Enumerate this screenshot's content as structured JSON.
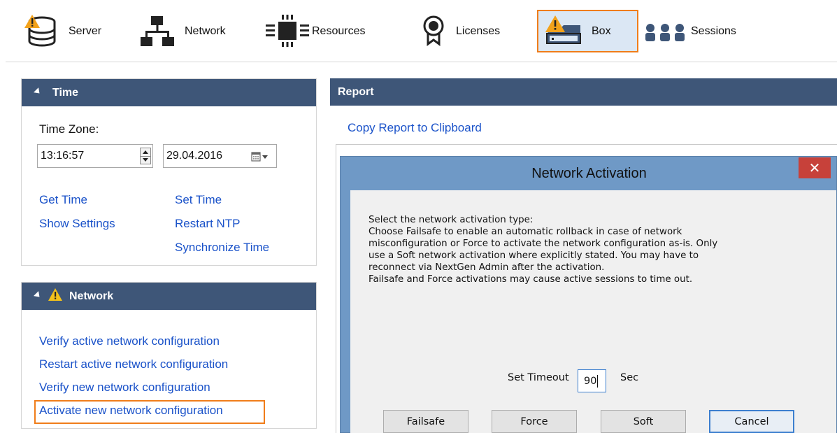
{
  "toolbar": {
    "items": [
      {
        "label": "Server",
        "icon": "database-warning-icon"
      },
      {
        "label": "Network",
        "icon": "network-icon"
      },
      {
        "label": "Resources",
        "icon": "chip-icon"
      },
      {
        "label": "Licenses",
        "icon": "certificate-icon"
      },
      {
        "label": "Box",
        "icon": "box-warning-icon",
        "selected": true
      },
      {
        "label": "Sessions",
        "icon": "users-icon"
      }
    ]
  },
  "time_panel": {
    "title": "Time",
    "timezone_label": "Time Zone:",
    "time_value": "13:16:57",
    "date_value": "29.04.2016",
    "links": {
      "get_time": "Get Time",
      "set_time": "Set Time",
      "show_settings": "Show Settings",
      "restart_ntp": "Restart NTP",
      "synchronize_time": "Synchronize Time"
    }
  },
  "network_panel": {
    "title": "Network",
    "links": {
      "verify_active": "Verify active network configuration",
      "restart_active": "Restart active network configuration",
      "verify_new": "Verify new network configuration",
      "activate_new": "Activate new network configuration"
    }
  },
  "report": {
    "title": "Report",
    "copy_link": "Copy Report to Clipboard"
  },
  "dialog": {
    "title": "Network Activation",
    "close": "✕",
    "message": [
      "Select the network activation type:",
      "Choose Failsafe to enable an automatic rollback in case of network",
      "misconfiguration or Force to activate the network configuration as-is. Only",
      "use a Soft network activation where explicitly stated. You may have to",
      "reconnect via NextGen Admin after the activation.",
      "Failsafe and Force activations may cause active sessions to time out."
    ],
    "timeout_label": "Set Timeout",
    "timeout_value": "90",
    "timeout_unit": "Sec",
    "buttons": {
      "failsafe": "Failsafe",
      "force": "Force",
      "soft": "Soft",
      "cancel": "Cancel"
    }
  },
  "colors": {
    "panel_header": "#3e5678",
    "link": "#1a52c9",
    "highlight": "#f07d1a",
    "dialog_frame": "#6f99c6",
    "close_button": "#c7413a"
  }
}
